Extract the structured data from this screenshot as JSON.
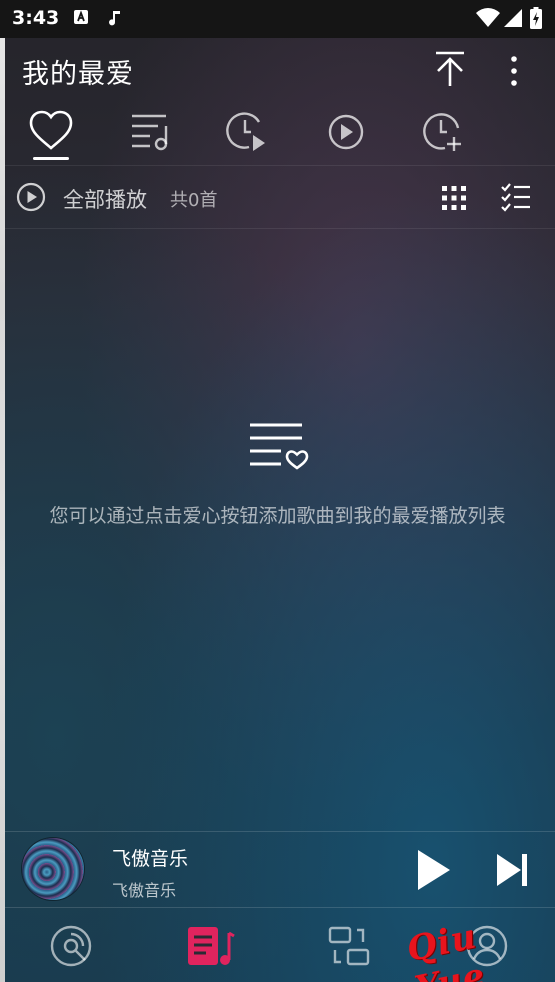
{
  "status_bar": {
    "time": "3:43"
  },
  "header": {
    "title": "我的最爱"
  },
  "tabs": [
    {
      "id": "favorites",
      "icon": "heart-icon",
      "active": true
    },
    {
      "id": "playlists",
      "icon": "music-list-icon",
      "active": false
    },
    {
      "id": "recent",
      "icon": "history-play-icon",
      "active": false
    },
    {
      "id": "play",
      "icon": "play-circle-icon",
      "active": false
    },
    {
      "id": "add-history",
      "icon": "clock-add-icon",
      "active": false
    }
  ],
  "play_all": {
    "label": "全部播放",
    "count": "共0首"
  },
  "empty_state": {
    "message": "您可以通过点击爱心按钮添加歌曲到我的最爱播放列表"
  },
  "player": {
    "title": "飞傲音乐",
    "artist": "飞傲音乐"
  },
  "bottom_nav": [
    {
      "id": "disc",
      "icon": "disc-icon",
      "active": false
    },
    {
      "id": "library",
      "icon": "library-icon",
      "active": true
    },
    {
      "id": "switch",
      "icon": "switch-icon",
      "active": false
    },
    {
      "id": "profile",
      "icon": "user-icon",
      "active": false
    }
  ],
  "watermark": {
    "text": "Qiu Yue"
  },
  "colors": {
    "accent": "#e0245e",
    "watermark": "#e8141d",
    "text_primary": "#ffffff"
  }
}
